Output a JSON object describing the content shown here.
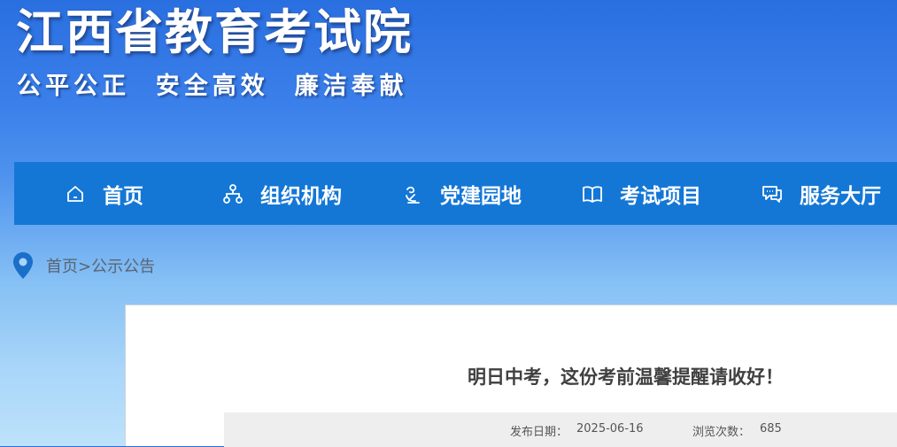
{
  "header": {
    "site_title": "江西省教育考试院",
    "slogan": "公平公正  安全高效  廉洁奉献"
  },
  "nav": {
    "items": [
      {
        "label": "首页",
        "icon": "home-icon"
      },
      {
        "label": "组织机构",
        "icon": "org-chart-icon"
      },
      {
        "label": "党建园地",
        "icon": "party-building-icon"
      },
      {
        "label": "考试项目",
        "icon": "book-icon"
      },
      {
        "label": "服务大厅",
        "icon": "chat-service-icon"
      }
    ]
  },
  "breadcrumb": {
    "icon": "location-pin-icon",
    "text": "首页>公示公告"
  },
  "article": {
    "title": "明日中考，这份考前温馨提醒请收好！",
    "date_label": "发布日期：",
    "date_value": "2025-06-16",
    "views_label": "浏览次数：",
    "views_value": "685"
  },
  "colors": {
    "nav_background": "#1477d6",
    "header_blue": "#2a6fe0",
    "pin_blue": "#1a6fc9"
  }
}
